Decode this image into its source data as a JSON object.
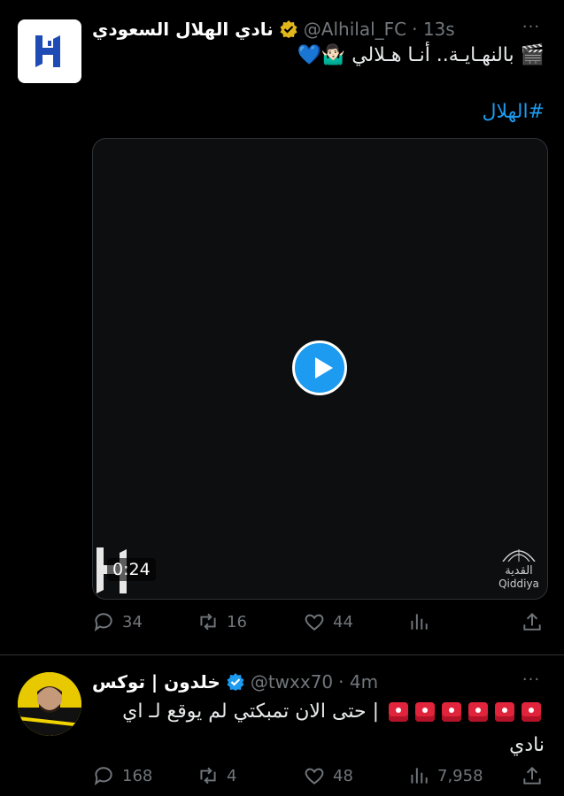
{
  "tweet1": {
    "display_name": "نادي الهلال السعودي",
    "handle": "@Alhilal_FC",
    "time": "· 13s",
    "text": "🎬 بالنهـايـة.. أنـا هـلالي 🤷🏻‍♂️💙",
    "hashtag": "#الهلال",
    "video": {
      "duration": "0:24",
      "brand_ar": "القدية",
      "brand_en": "Qiddiya"
    },
    "stats": {
      "replies": "34",
      "retweets": "16",
      "likes": "44"
    }
  },
  "tweet2": {
    "display_name": "خلدون | توكس",
    "handle": "@twxx70",
    "time": "· 4m",
    "text": "| حتى الان تمبكتي لم يوقع لـ اي نادي",
    "siren_count": 6,
    "stats": {
      "replies": "168",
      "retweets": "4",
      "likes": "48",
      "views": "7,958"
    }
  },
  "more_icon": "···",
  "colors": {
    "accent": "#1d9bf0",
    "muted": "#71767b",
    "background": "#000000",
    "verified_gold": "#e2b719"
  }
}
